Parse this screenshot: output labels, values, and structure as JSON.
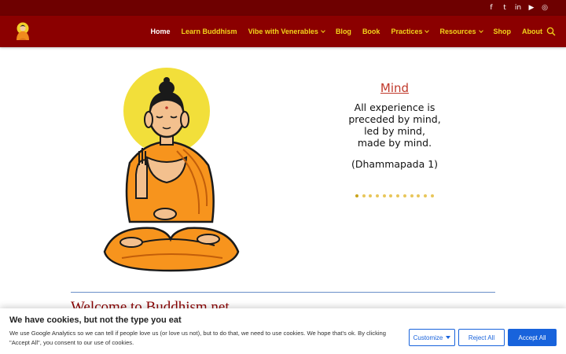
{
  "social": {
    "icons": [
      "facebook-icon",
      "twitter-icon",
      "linkedin-icon",
      "youtube-icon",
      "instagram-icon"
    ],
    "glyphs": [
      "f",
      "t",
      "in",
      "▶",
      "◎"
    ]
  },
  "colors": {
    "topbar": "#6e0000",
    "header": "#8b0000",
    "nav_text": "#f2d41b",
    "nav_active": "#ffffff",
    "quote_title": "#c0392b",
    "button_blue": "#1863dc"
  },
  "nav": {
    "items": [
      {
        "label": "Home",
        "active": true,
        "dropdown": false
      },
      {
        "label": "Learn Buddhism",
        "active": false,
        "dropdown": false
      },
      {
        "label": "Vibe with Venerables",
        "active": false,
        "dropdown": true
      },
      {
        "label": "Blog",
        "active": false,
        "dropdown": false
      },
      {
        "label": "Book",
        "active": false,
        "dropdown": false
      },
      {
        "label": "Practices",
        "active": false,
        "dropdown": true
      },
      {
        "label": "Resources",
        "active": false,
        "dropdown": true
      },
      {
        "label": "Shop",
        "active": false,
        "dropdown": false
      },
      {
        "label": "About",
        "active": false,
        "dropdown": false
      }
    ]
  },
  "slider": {
    "title": "Mind",
    "text_lines": [
      "All experience is",
      "preceded by mind,",
      "led by mind,",
      "made by mind."
    ],
    "source": "(Dhammapada 1)",
    "dot_count": 12,
    "active_dot": 1
  },
  "welcome": {
    "heading": "Welcome to Buddhism.net"
  },
  "cookie": {
    "title": "We have cookies, but not the type you eat",
    "text": "We use Google Analytics so we can tell if people love us (or love us not), but to do that, we need to use cookies. We hope that's ok. By clicking \"Accept All\", you consent to our use of cookies.",
    "customize": "Customize",
    "reject": "Reject All",
    "accept": "Accept All"
  }
}
